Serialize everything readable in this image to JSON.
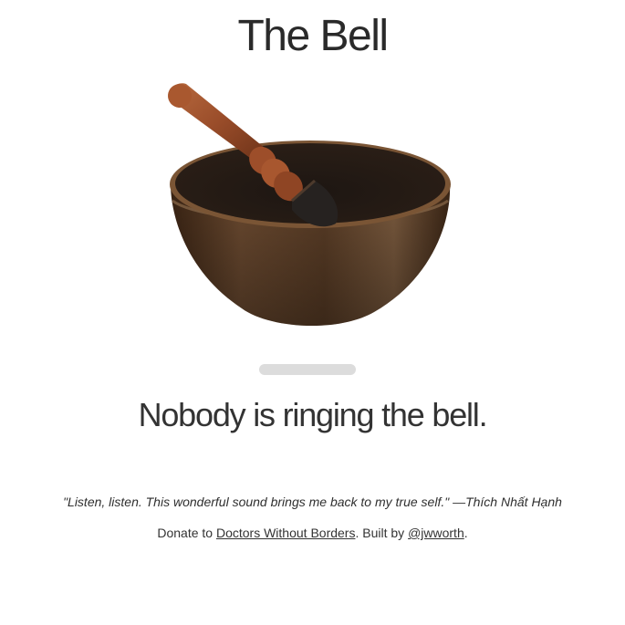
{
  "page": {
    "title": "The Bell"
  },
  "bell": {
    "image_name": "singing-bowl-with-mallet"
  },
  "progress": {
    "value": 0
  },
  "status": {
    "text": "Nobody is ringing the bell."
  },
  "quote": {
    "text": "\"Listen, listen. This wonderful sound brings me back to my true self.\" —Thích Nhất Hạnh"
  },
  "footer": {
    "donate_prefix": "Donate to ",
    "donate_link": "Doctors Without Borders",
    "built_prefix": ". Built by ",
    "author_link": "@jwworth",
    "suffix": "."
  },
  "colors": {
    "text": "#333333",
    "progress_track": "#dcdcdc",
    "bowl": "#5a3b22",
    "mallet": "#9b4f2b"
  }
}
